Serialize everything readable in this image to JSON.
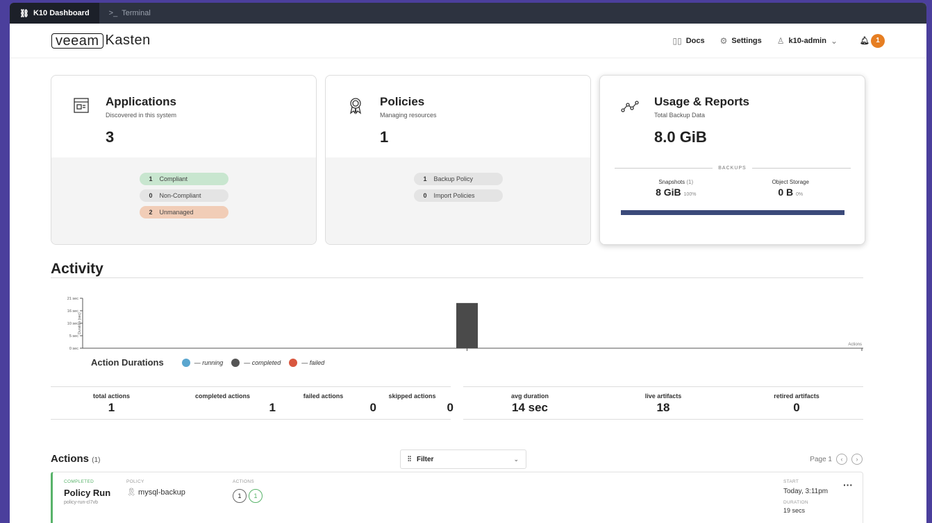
{
  "tabs": [
    {
      "label": "K10 Dashboard",
      "icon": "link-icon"
    },
    {
      "label": "Terminal",
      "icon": "terminal-icon"
    }
  ],
  "header": {
    "logo_veeam": "veeam",
    "logo_kasten": "Kasten",
    "docs": "Docs",
    "settings": "Settings",
    "user": "k10-admin",
    "notifications": "1"
  },
  "cards": {
    "applications": {
      "title": "Applications",
      "subtitle": "Discovered in this system",
      "count": "3",
      "pills": [
        {
          "count": "1",
          "label": "Compliant"
        },
        {
          "count": "0",
          "label": "Non-Compliant"
        },
        {
          "count": "2",
          "label": "Unmanaged"
        }
      ]
    },
    "policies": {
      "title": "Policies",
      "subtitle": "Managing resources",
      "count": "1",
      "pills": [
        {
          "count": "1",
          "label": "Backup Policy"
        },
        {
          "count": "0",
          "label": "Import Policies"
        }
      ]
    },
    "usage": {
      "title": "Usage & Reports",
      "subtitle": "Total Backup Data",
      "total": "8.0 GiB",
      "backups_label": "BACKUPS",
      "snapshots_label": "Snapshots",
      "snapshots_count": "(1)",
      "snapshots_value": "8 GiB",
      "snapshots_pct": "100%",
      "object_label": "Object Storage",
      "object_value": "0 B",
      "object_pct": "0%"
    }
  },
  "activity": {
    "title": "Activity",
    "legend_title": "Action Durations",
    "legend": [
      {
        "label": "— running",
        "color": "#5aa6cf"
      },
      {
        "label": "— completed",
        "color": "#555555"
      },
      {
        "label": "— failed",
        "color": "#d9573f"
      }
    ]
  },
  "chart_data": {
    "type": "bar",
    "ylabel": "Duration (sec)",
    "xlabel": "Actions",
    "yticks": [
      "21 sec",
      "16 sec",
      "10 sec",
      "5 sec",
      "0 sec"
    ],
    "ylim": [
      0,
      21
    ],
    "series": [
      {
        "name": "completed",
        "values": [
          19
        ]
      }
    ],
    "categories": [
      ""
    ]
  },
  "stats_left": [
    {
      "label": "total actions",
      "value": "1"
    },
    {
      "label": "completed actions",
      "value": "1"
    },
    {
      "label": "failed actions",
      "value": "0"
    },
    {
      "label": "skipped actions",
      "value": "0"
    }
  ],
  "stats_right": [
    {
      "label": "avg duration",
      "value": "14 sec"
    },
    {
      "label": "live artifacts",
      "value": "18"
    },
    {
      "label": "retired artifacts",
      "value": "0"
    }
  ],
  "actions": {
    "title": "Actions",
    "count": "(1)",
    "filter": "Filter",
    "page": "Page 1",
    "row": {
      "status": "COMPLETED",
      "name": "Policy Run",
      "id": "policy-run-cl7vb",
      "policy_label": "POLICY",
      "policy": "mysql-backup",
      "actions_label": "ACTIONS",
      "action_counts": [
        "1",
        "1"
      ],
      "start_label": "START",
      "start": "Today, 3:11pm",
      "duration_label": "DURATION",
      "duration": "19 secs"
    }
  }
}
